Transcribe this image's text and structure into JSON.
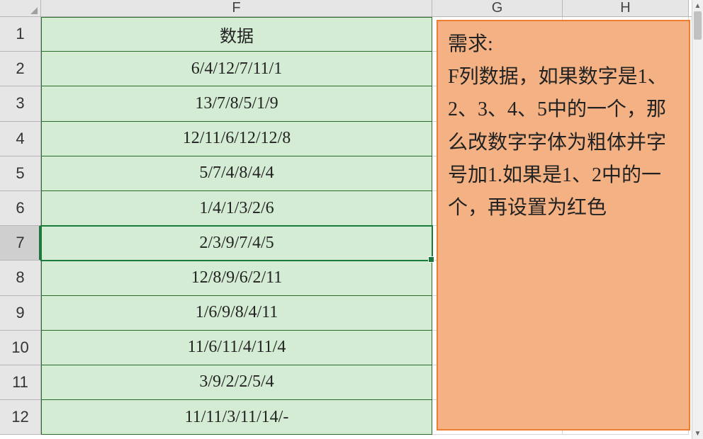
{
  "columns": {
    "F": "F",
    "G": "G",
    "H": "H"
  },
  "row_numbers": [
    "1",
    "2",
    "3",
    "4",
    "5",
    "6",
    "7",
    "8",
    "9",
    "10",
    "11",
    "12"
  ],
  "header_cell": "数据",
  "rows_F": [
    "6/4/12/7/11/1",
    "13/7/8/5/1/9",
    "12/11/6/12/12/8",
    "5/7/4/8/4/4",
    "1/4/1/3/2/6",
    "2/3/9/7/4/5",
    "12/8/9/6/2/11",
    "1/6/9/8/4/11",
    "11/6/11/4/11/4",
    "3/9/2/2/5/4",
    "11/11/3/11/14/-"
  ],
  "active_row_index": 7,
  "note_text": "需求:\nF列数据，如果数字是1、2、3、4、5中的一个，那么改数字字体为粗体并字号加1.如果是1、2中的一个，再设置为红色",
  "colors": {
    "fill_F": "#d4ecd4",
    "border_F": "#2d6b2d",
    "note_fill": "#f4b183",
    "note_border": "#ed7d31",
    "selection": "#1a7c3b"
  }
}
